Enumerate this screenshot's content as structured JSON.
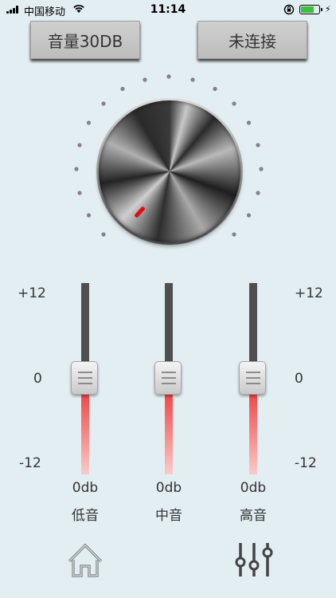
{
  "status_bar": {
    "carrier": "中国移动",
    "time": "11:14",
    "battery_level": 0.75
  },
  "header": {
    "volume_button": "音量30DB",
    "connect_button": "未连接"
  },
  "knob": {
    "dot_count": 19
  },
  "eq": {
    "scale_left": {
      "top": "+12",
      "mid": "0",
      "bottom": "-12"
    },
    "scale_right": {
      "top": "+12",
      "mid": "0",
      "bottom": "-12"
    },
    "sliders": [
      {
        "value": "0db",
        "name": "低音",
        "level": 0
      },
      {
        "value": "0db",
        "name": "中音",
        "level": 0
      },
      {
        "value": "0db",
        "name": "高音",
        "level": 0
      }
    ]
  },
  "nav": {
    "home_icon": "home-icon",
    "equalizer_icon": "equalizer-icon"
  },
  "colors": {
    "background": "#e3eef2",
    "accent_red": "#e10d0d",
    "battery_green": "#3cc13b"
  }
}
